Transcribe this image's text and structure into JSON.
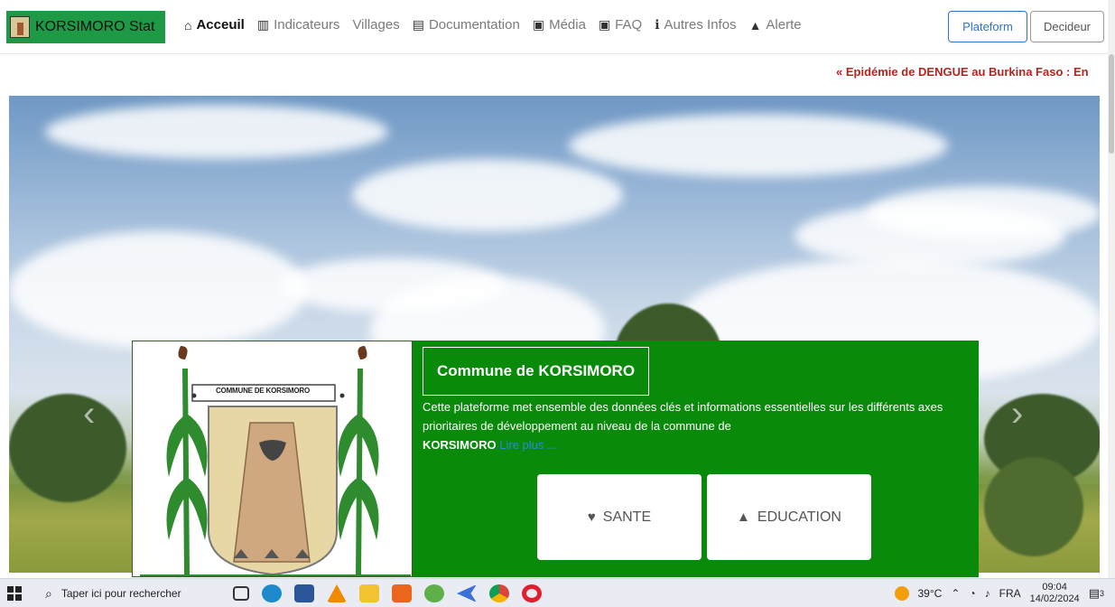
{
  "navbar": {
    "brand": "KORSIMORO Stat",
    "items": [
      {
        "label": "Acceuil",
        "icon": "home-icon",
        "glyph": "⌂"
      },
      {
        "label": "Indicateurs",
        "icon": "chart-icon",
        "glyph": "▥"
      },
      {
        "label": "Villages",
        "icon": "",
        "glyph": ""
      },
      {
        "label": "Documentation",
        "icon": "book-icon",
        "glyph": "▤"
      },
      {
        "label": "Média",
        "icon": "media-icon",
        "glyph": "▣"
      },
      {
        "label": "FAQ",
        "icon": "faq-icon",
        "glyph": "▣"
      },
      {
        "label": "Autres Infos",
        "icon": "info-icon",
        "glyph": "ℹ"
      },
      {
        "label": "Alerte",
        "icon": "warning-icon",
        "glyph": "▲"
      }
    ],
    "btn_plateform": "Plateform",
    "btn_decideur": "Decideur"
  },
  "ticker": "« Epidémie de DENGUE au Burkina Faso : En",
  "card": {
    "logo_banner": "COMMUNE DE KORSIMORO",
    "title": "Commune de KORSIMORO",
    "desc": "Cette plateforme met ensemble des données clés et informations essentielles sur les différents axes prioritaires de développement au niveau de la commune de",
    "desc_strong": "KORSIMORO",
    "read_more": "Lire plus ...",
    "btn_sante": "SANTE",
    "btn_education": "EDUCATION"
  },
  "taskbar": {
    "search_placeholder": "Taper ici pour rechercher",
    "temp": "39°C",
    "lang": "FRA",
    "time": "09:04",
    "date": "14/02/2024",
    "notif_count": "3"
  },
  "colors": {
    "brand_green": "#1e9a46",
    "card_green": "#0a8a0a",
    "ticker_red": "#b3261e",
    "link_blue": "#2f6fd9"
  }
}
